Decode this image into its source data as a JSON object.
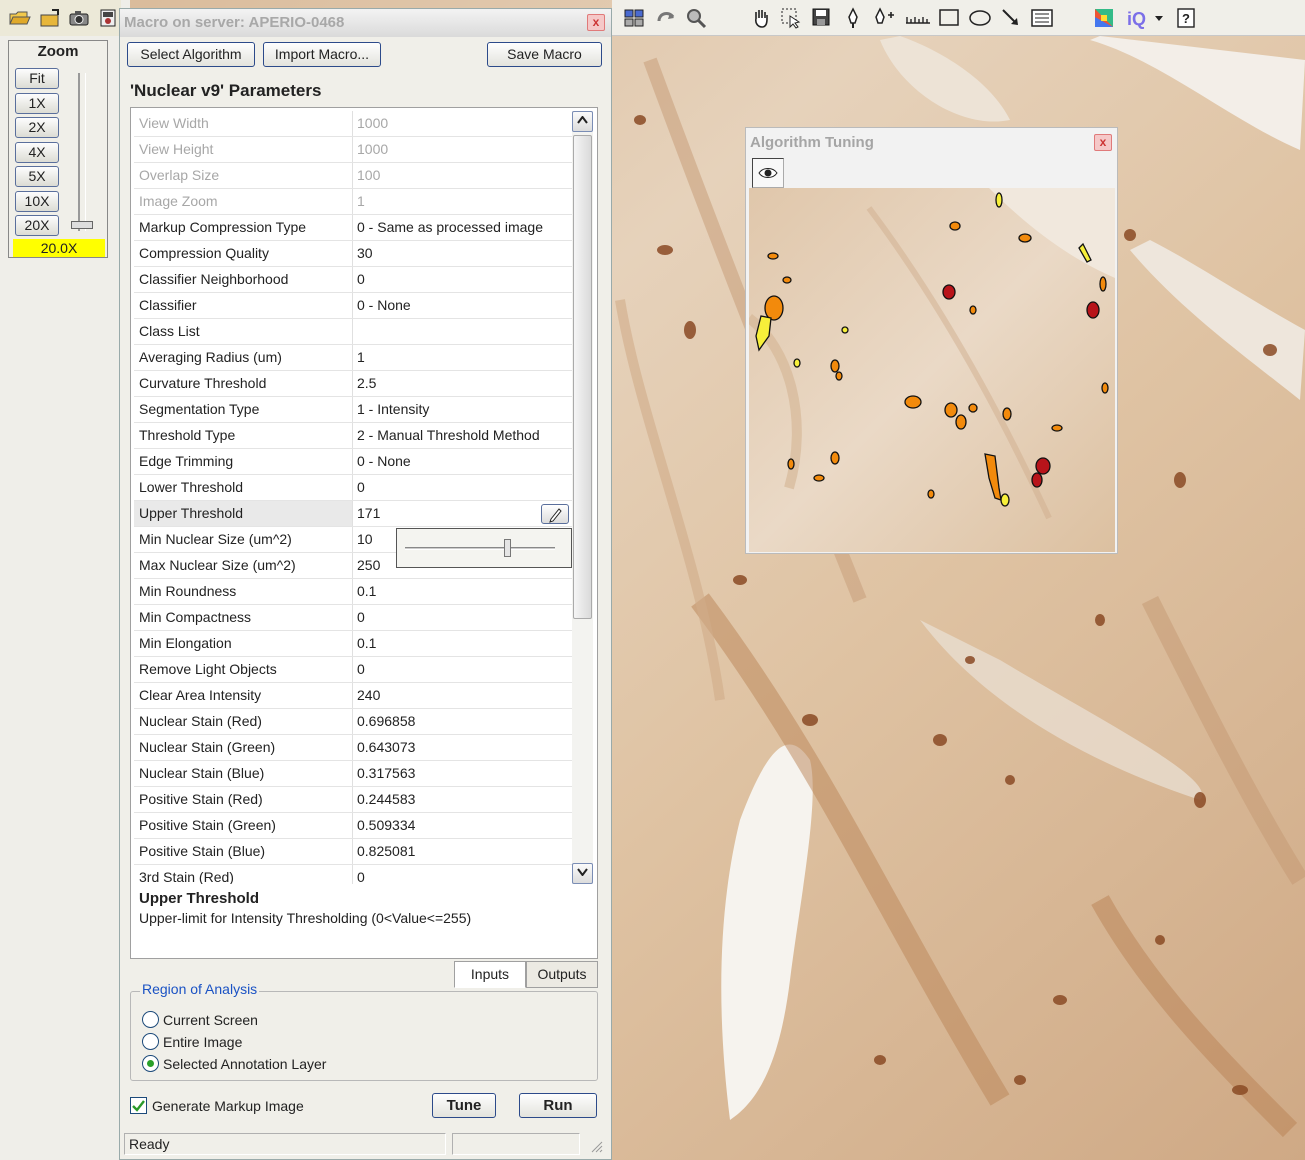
{
  "app": {
    "macro_title": "Macro on server: APERIO-0468",
    "close_symbol": "x"
  },
  "zoom": {
    "title": "Zoom",
    "buttons": [
      "Fit",
      "1X",
      "2X",
      "4X",
      "5X",
      "10X",
      "20X"
    ],
    "readout": "20.0X"
  },
  "macro": {
    "select_algorithm": "Select Algorithm",
    "import_macro": "Import Macro...",
    "save_macro": "Save Macro",
    "params_title": "'Nuclear v9'  Parameters",
    "parameters": [
      {
        "name": "View Width",
        "value": "1000",
        "disabled": true
      },
      {
        "name": "View Height",
        "value": "1000",
        "disabled": true
      },
      {
        "name": "Overlap Size",
        "value": "100",
        "disabled": true
      },
      {
        "name": "Image Zoom",
        "value": "1",
        "disabled": true
      },
      {
        "name": "Markup Compression Type",
        "value": "0 - Same as processed image"
      },
      {
        "name": "Compression Quality",
        "value": "30"
      },
      {
        "name": "Classifier Neighborhood",
        "value": "0"
      },
      {
        "name": "Classifier",
        "value": "0 - None"
      },
      {
        "name": "Class List",
        "value": ""
      },
      {
        "name": "Averaging Radius (um)",
        "value": "1"
      },
      {
        "name": "Curvature Threshold",
        "value": "2.5"
      },
      {
        "name": "Segmentation Type",
        "value": "1 - Intensity"
      },
      {
        "name": "Threshold Type",
        "value": "2 - Manual Threshold Method"
      },
      {
        "name": "Edge Trimming",
        "value": "0 - None"
      },
      {
        "name": "Lower Threshold",
        "value": "0"
      },
      {
        "name": "Upper Threshold",
        "value": "171",
        "selected": true
      },
      {
        "name": "Min Nuclear Size (um^2)",
        "value": "10"
      },
      {
        "name": "Max Nuclear Size (um^2)",
        "value": "250"
      },
      {
        "name": "Min Roundness",
        "value": "0.1"
      },
      {
        "name": "Min Compactness",
        "value": "0"
      },
      {
        "name": "Min Elongation",
        "value": "0.1"
      },
      {
        "name": "Remove Light Objects",
        "value": "0"
      },
      {
        "name": "Clear Area Intensity",
        "value": "240"
      },
      {
        "name": "Nuclear Stain (Red)",
        "value": "0.696858"
      },
      {
        "name": "Nuclear Stain (Green)",
        "value": "0.643073"
      },
      {
        "name": "Nuclear Stain (Blue)",
        "value": "0.317563"
      },
      {
        "name": "Positive Stain (Red)",
        "value": "0.244583"
      },
      {
        "name": "Positive Stain (Green)",
        "value": "0.509334"
      },
      {
        "name": "Positive Stain (Blue)",
        "value": "0.825081"
      },
      {
        "name": "3rd Stain (Red)",
        "value": "0"
      }
    ],
    "slider_value": 0.68,
    "description_title": "Upper Threshold",
    "description_text": "Upper-limit for Intensity Thresholding (0<Value<=255)",
    "tabs": [
      "Inputs",
      "Outputs"
    ],
    "active_tab": "Inputs",
    "region_legend": "Region of Analysis",
    "region_options": [
      "Current Screen",
      "Entire Image",
      "Selected Annotation Layer"
    ],
    "region_selected": "Selected Annotation Layer",
    "generate_markup": "Generate Markup Image",
    "generate_markup_checked": true,
    "tune": "Tune",
    "run": "Run",
    "status": "Ready"
  },
  "tuning": {
    "title": "Algorithm Tuning"
  },
  "toolbar_icons": [
    "open-folder-icon",
    "open-file-icon",
    "camera-icon",
    "slide-icon",
    "overview-icon",
    "rotate-icon",
    "magnify-icon",
    "hand-pan-icon",
    "select-arrow-icon",
    "save-region-icon",
    "pen-icon",
    "pen-plus-icon",
    "ruler-icon",
    "rectangle-icon",
    "ellipse-icon",
    "arrow-icon",
    "list-icon",
    "color-icon",
    "iq-icon",
    "dropdown-arrow-icon",
    "help-icon"
  ],
  "colors": {
    "accent_blue": "#1a52c4",
    "readout_yellow": "#ffff00",
    "markup_yellow": "#f7ef3a",
    "markup_orange": "#f28a0c",
    "markup_red": "#b8141a"
  }
}
